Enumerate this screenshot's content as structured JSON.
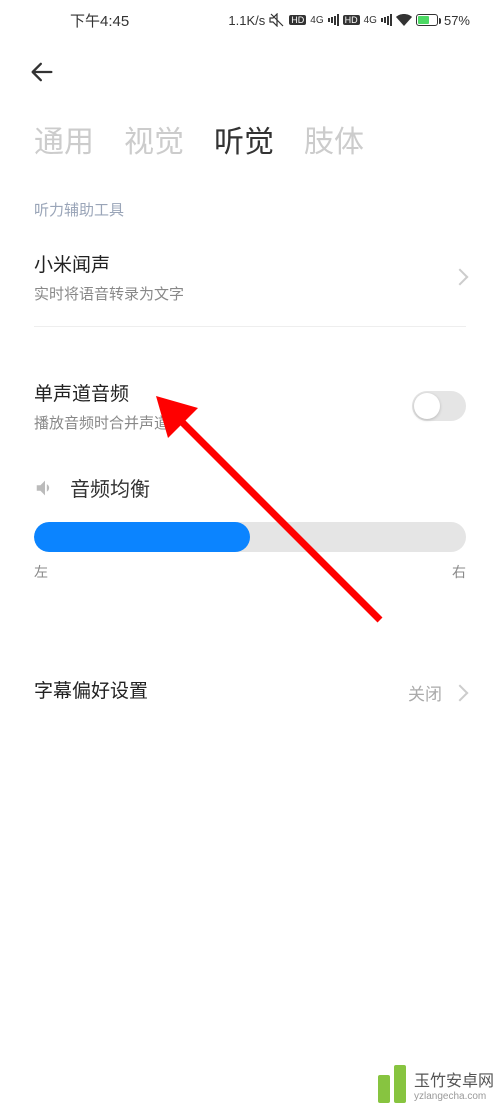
{
  "status_bar": {
    "time": "下午4:45",
    "speed": "1.1K/s",
    "battery_percent": "57%",
    "sim1": "4G",
    "sim2": "4G",
    "hd1": "HD",
    "hd2": "HD"
  },
  "tabs": {
    "general": "通用",
    "vision": "视觉",
    "hearing": "听觉",
    "physical": "肢体"
  },
  "section_headers": {
    "hearing_tools": "听力辅助工具"
  },
  "items": {
    "xiaomi_sound": {
      "title": "小米闻声",
      "subtitle": "实时将语音转录为文字"
    },
    "mono_audio": {
      "title": "单声道音频",
      "subtitle": "播放音频时合并声道"
    },
    "audio_balance": {
      "label": "音频均衡",
      "left": "左",
      "right": "右"
    },
    "subtitle_pref": {
      "title": "字幕偏好设置",
      "value": "关闭"
    }
  },
  "watermark": {
    "text": "玉竹安卓网",
    "sub": "yzlangecha.com"
  }
}
